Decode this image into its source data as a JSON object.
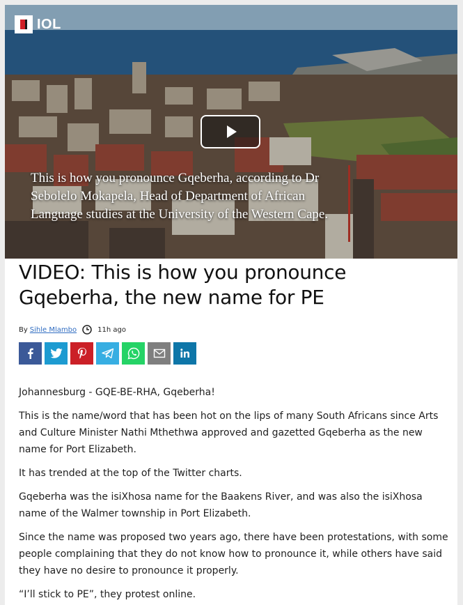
{
  "brand": {
    "logo_text": "IOL"
  },
  "video": {
    "caption": "This is how you pronounce Gqeberha, according to Dr Sebolelo Mokapela, Head of Department of African Language studies at the University of the Western Cape."
  },
  "article": {
    "headline": "VIDEO: This is how you pronounce Gqeberha, the new name for PE",
    "byline_prefix": "By",
    "author": "Sihle Mlambo",
    "time_ago": "11h ago",
    "paragraphs": [
      "Johannesburg - GQE-BE-RHA, Gqeberha!",
      "This is the name/word that has been hot on the lips of many South Africans since Arts and Culture Minister Nathi Mthethwa approved and gazetted Gqeberha as the new name for Port Elizabeth.",
      "It has trended at the top of the Twitter charts.",
      "Gqeberha was the isiXhosa name for the Baakens River, and was also the isiXhosa name of the Walmer township in Port Elizabeth.",
      "Since the name was proposed two years ago, there have been protestations, with some people complaining that they do not know how to pronounce it, while others have said they have no desire to pronounce it properly.",
      "“I’ll stick to PE”, they protest online."
    ]
  },
  "share": [
    {
      "icon": "facebook-icon",
      "color": "#3b5998"
    },
    {
      "icon": "twitter-icon",
      "color": "#1d9bd1"
    },
    {
      "icon": "pinterest-icon",
      "color": "#cb2027"
    },
    {
      "icon": "telegram-icon",
      "color": "#37aee2"
    },
    {
      "icon": "whatsapp-icon",
      "color": "#25d366"
    },
    {
      "icon": "email-icon",
      "color": "#7f7f7f"
    },
    {
      "icon": "linkedin-icon",
      "color": "#0e76a8"
    }
  ]
}
